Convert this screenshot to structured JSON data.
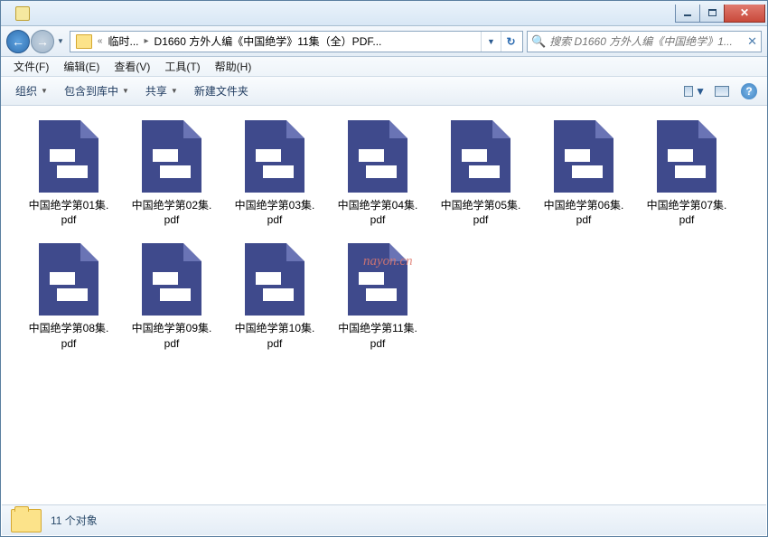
{
  "window": {
    "minimize": "minimize",
    "maximize": "maximize",
    "close": "close"
  },
  "breadcrumb": {
    "seg1": "临时...",
    "seg2": "D1660 方外人编《中国绝学》11集（全）PDF..."
  },
  "search": {
    "placeholder": "搜索 D1660 方外人编《中国绝学》1..."
  },
  "menu": {
    "file": "文件(F)",
    "edit": "编辑(E)",
    "view": "查看(V)",
    "tools": "工具(T)",
    "help": "帮助(H)"
  },
  "toolbar": {
    "organize": "组织",
    "include": "包含到库中",
    "share": "共享",
    "newfolder": "新建文件夹"
  },
  "files": [
    {
      "name": "中国绝学第01集.pdf"
    },
    {
      "name": "中国绝学第02集.pdf"
    },
    {
      "name": "中国绝学第03集.pdf"
    },
    {
      "name": "中国绝学第04集.pdf"
    },
    {
      "name": "中国绝学第05集.pdf"
    },
    {
      "name": "中国绝学第06集.pdf"
    },
    {
      "name": "中国绝学第07集.pdf"
    },
    {
      "name": "中国绝学第08集.pdf"
    },
    {
      "name": "中国绝学第09集.pdf"
    },
    {
      "name": "中国绝学第10集.pdf"
    },
    {
      "name": "中国绝学第11集.pdf"
    }
  ],
  "watermark": "nayon.cn",
  "status": {
    "count_text": "11 个对象"
  }
}
